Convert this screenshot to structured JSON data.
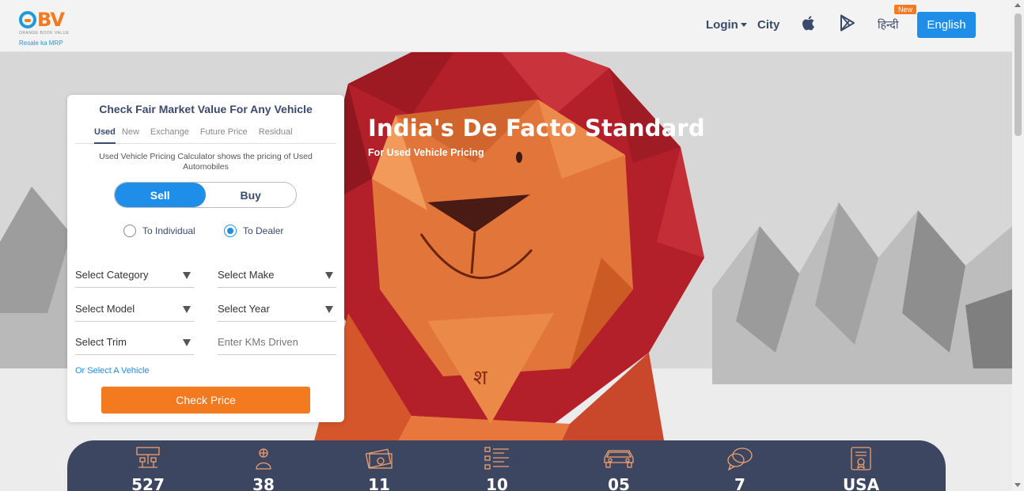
{
  "logo": {
    "brand": "BV",
    "small_text": "ORANGE BOOK VALUE",
    "tagline": "Resale ka MRP"
  },
  "nav": {
    "login": "Login",
    "city": "City",
    "apple_icon": "apple-icon",
    "play_icon": "google-play-icon",
    "hindi": "हिन्दी",
    "new_badge": "New",
    "english": "English"
  },
  "hero": {
    "title": "India's De Facto Standard",
    "subtitle": "For Used Vehicle Pricing"
  },
  "card": {
    "title": "Check Fair Market Value For Any Vehicle",
    "tabs": [
      "Used",
      "New",
      "Exchange",
      "Future Price",
      "Residual"
    ],
    "active_tab": "Used",
    "description": "Used Vehicle Pricing Calculator shows the pricing of Used Automobiles",
    "toggle": {
      "sell": "Sell",
      "buy": "Buy",
      "selected": "Sell"
    },
    "radios": {
      "individual": "To Individual",
      "dealer": "To Dealer",
      "selected": "To Dealer"
    },
    "fields": {
      "category": "Select Category",
      "make": "Select Make",
      "model": "Select Model",
      "year": "Select Year",
      "trim": "Select Trim",
      "kms_placeholder": "Enter KMs Driven"
    },
    "or_select": "Or Select A Vehicle",
    "check_price": "Check Price"
  },
  "stats": [
    {
      "icon": "users-network-icon",
      "value": "527"
    },
    {
      "icon": "globe-person-icon",
      "value": "38"
    },
    {
      "icon": "money-icon",
      "value": "11"
    },
    {
      "icon": "list-icon",
      "value": "10"
    },
    {
      "icon": "car-icon",
      "value": "05"
    },
    {
      "icon": "chat-icon",
      "value": "7"
    },
    {
      "icon": "certificate-icon",
      "value": "USA"
    }
  ],
  "colors": {
    "brand_orange": "#f47a20",
    "brand_blue": "#1e8ee8",
    "navy": "#3c4660"
  }
}
